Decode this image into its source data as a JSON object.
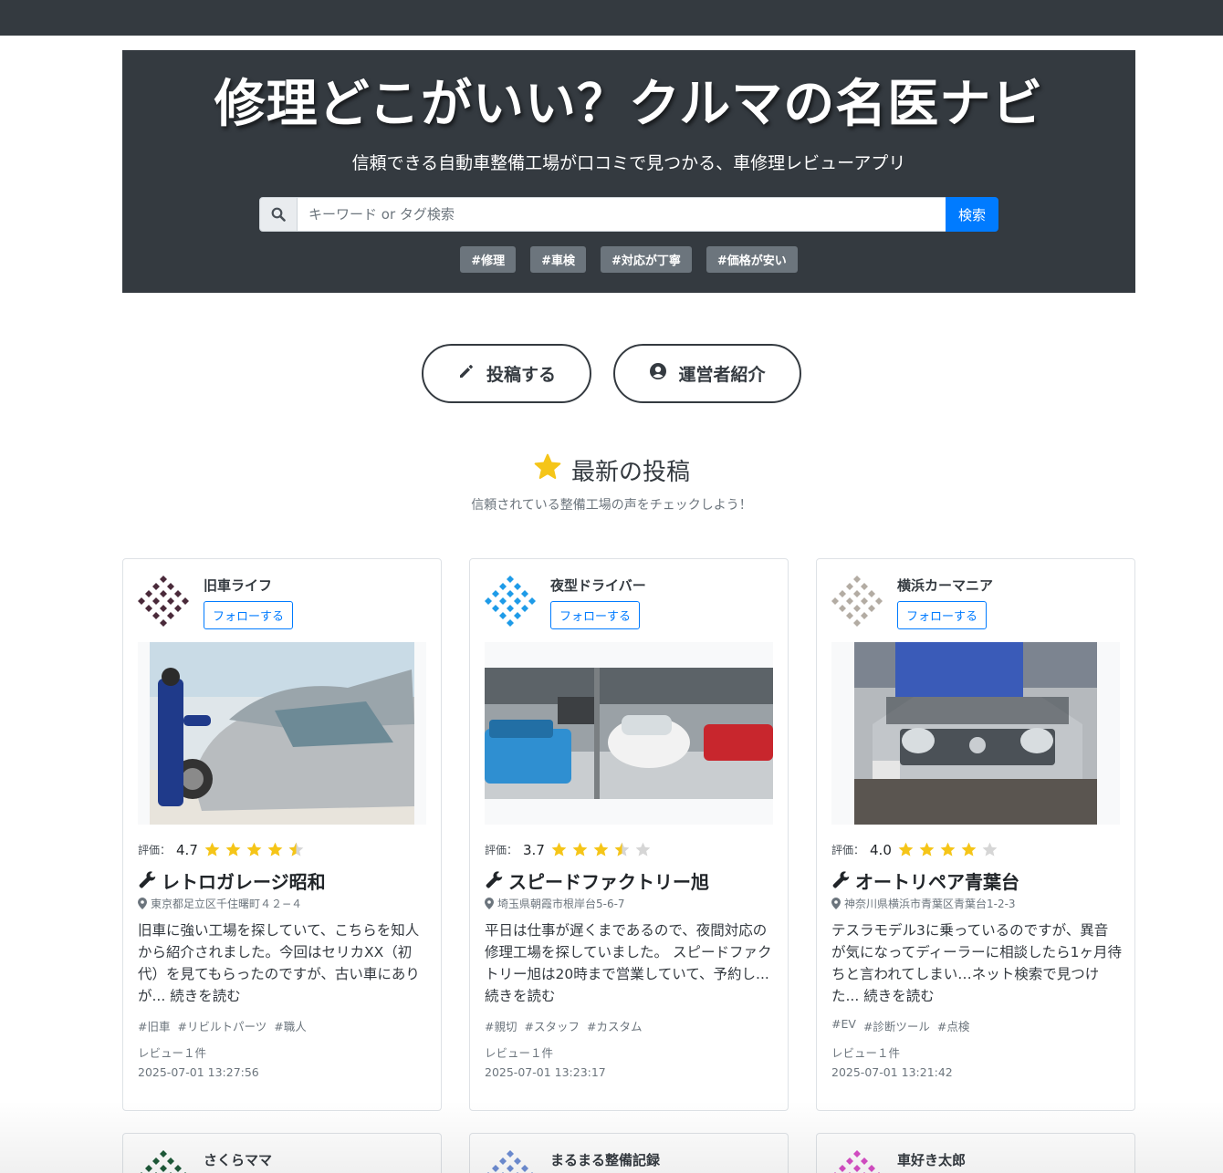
{
  "hero": {
    "title": "修理どこがいい？クルマの名医ナビ",
    "subtitle": "信頼できる自動車整備工場が口コミで見つかる、車修理レビューアプリ",
    "search_placeholder": "キーワード or タグ検索",
    "search_button": "検索",
    "tags": [
      "#修理",
      "#車検",
      "#対応が丁寧",
      "#価格が安い"
    ]
  },
  "actions": {
    "post_label": "投稿する",
    "about_label": "運営者紹介"
  },
  "section": {
    "title": "最新の投稿",
    "subtitle": "信頼されている整備工場の声をチェックしよう！"
  },
  "follow_label": "フォローする",
  "posts": [
    {
      "user": "旧車ライフ",
      "avatar_color": "#4a2a3a",
      "rating_label": "評価：",
      "rating": "4.7",
      "rating_value": 4.7,
      "shop": "レトロガレージ昭和",
      "address": "東京都足立区千住曙町４２−４",
      "excerpt": "旧車に強い工場を探していて、こちらを知人から紹介されました。今回はセリカXX（初代）を見てもらったのですが、古い車にありが... 続きを読む",
      "tags": [
        "#旧車",
        "#リビルトパーツ",
        "#職人"
      ],
      "reviews": "レビュー１件",
      "date": "2025-07-01 13:27:56"
    },
    {
      "user": "夜型ドライバー",
      "avatar_color": "#1e9be8",
      "rating_label": "評価：",
      "rating": "3.7",
      "rating_value": 3.7,
      "shop": "スピードファクトリー旭",
      "address": "埼玉県朝霞市根岸台5-6-7",
      "excerpt": "平日は仕事が遅くまであるので、夜間対応の修理工場を探していました。 スピードファクトリー旭は20時まで営業していて、予約し... 続きを読む",
      "tags": [
        "#親切",
        "#スタッフ",
        "#カスタム"
      ],
      "reviews": "レビュー１件",
      "date": "2025-07-01 13:23:17"
    },
    {
      "user": "横浜カーマニア",
      "avatar_color": "#b3aca3",
      "rating_label": "評価：",
      "rating": "4.0",
      "rating_value": 4.0,
      "shop": "オートリペア青葉台",
      "address": "神奈川県横浜市青葉区青葉台1-2-3",
      "excerpt": "テスラモデル3に乗っているのですが、異音が気になってディーラーに相談したら1ヶ月待ちと言われてしまい…ネット検索で見つけた... 続きを読む",
      "tags": [
        "#EV",
        "#診断ツール",
        "#点検"
      ],
      "reviews": "レビュー１件",
      "date": "2025-07-01 13:21:42"
    }
  ],
  "next_posts": [
    {
      "user": "さくらママ",
      "avatar_color": "#1f5b3a"
    },
    {
      "user": "まるまる整備記録",
      "avatar_color": "#6f8fd6"
    },
    {
      "user": "車好き太郎",
      "avatar_color": "#d94fc8"
    }
  ],
  "colors": {
    "star": "#f5c518",
    "star_empty": "#d6d6d6",
    "primary": "#007bff",
    "dark": "#343a40"
  }
}
